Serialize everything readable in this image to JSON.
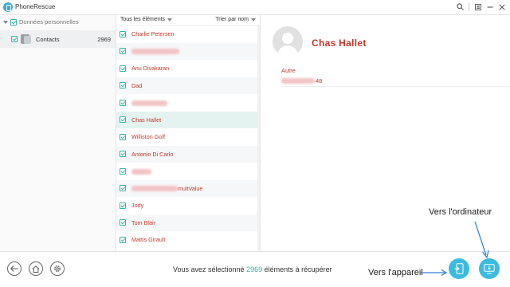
{
  "app": {
    "title": "PhoneRescue"
  },
  "titlebar": {
    "icons": [
      "search-icon",
      "menu-icon",
      "minimize-icon",
      "close-icon"
    ]
  },
  "sidebar": {
    "header": "Données personnelles",
    "items": [
      {
        "label": "Contacts",
        "count": "2969"
      }
    ]
  },
  "list": {
    "filter_label": "Tous les éléments",
    "sort_label": "Trier par nom",
    "rows": [
      {
        "name": "Charlie  Petersen",
        "selected": false
      },
      {
        "name": "",
        "blur": 60,
        "selected": false
      },
      {
        "name": "Anu  Divakaran",
        "selected": false
      },
      {
        "name": "Dad",
        "selected": false
      },
      {
        "name": "",
        "blur": 45,
        "selected": false
      },
      {
        "name": "Chas  Hallet",
        "selected": true
      },
      {
        "name": "Williston  Golf",
        "selected": false
      },
      {
        "name": "Antonio  Di Carlo",
        "selected": false
      },
      {
        "name": "",
        "blur": 25,
        "selected": false
      },
      {
        "name": "",
        "blur": 58,
        "suffix": "multValue",
        "selected": false
      },
      {
        "name": "Jody",
        "selected": false
      },
      {
        "name": "Tom  Blair",
        "selected": false
      },
      {
        "name": "Mattis  Girault",
        "selected": false
      }
    ]
  },
  "detail": {
    "name": "Chas  Hallet",
    "field_label": "Autre",
    "field_value_suffix": "48"
  },
  "footer": {
    "status_prefix": "Vous avez sélectionné",
    "status_count": "2969",
    "status_suffix": "éléments à récupérer"
  },
  "annotations": {
    "to_device": "Vers l'appareil",
    "to_computer": "Vers l'ordinateur"
  },
  "colors": {
    "accent": "#3ab3a4",
    "name_red": "#c0392b",
    "action_blue": "#3bbbe0",
    "arrow_blue": "#2e7fd6"
  }
}
